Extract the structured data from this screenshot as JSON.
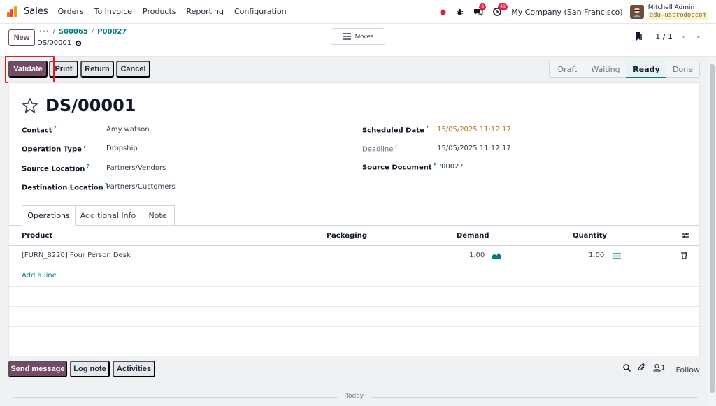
{
  "navbar": {
    "app_name": "Sales",
    "menu": [
      "Orders",
      "To Invoice",
      "Products",
      "Reporting",
      "Configuration"
    ],
    "messages_badge": "8",
    "activities_badge": "48",
    "company": "My Company (San Francisco)",
    "user_name": "Mitchell Admin",
    "user_db": "edu-userodoocom"
  },
  "control": {
    "new_label": "New",
    "breadcrumb": [
      "S00065",
      "P00027"
    ],
    "record_name": "DS/00001",
    "moves_label": "Moves",
    "pager": "1 / 1"
  },
  "actions": {
    "validate": "Validate",
    "print": "Print",
    "return": "Return",
    "cancel": "Cancel"
  },
  "status": {
    "stages": [
      "Draft",
      "Waiting",
      "Ready",
      "Done"
    ],
    "active": "Ready"
  },
  "form": {
    "title": "DS/00001",
    "contact_label": "Contact",
    "contact": "Amy watson",
    "operation_type_label": "Operation Type",
    "operation_type": "Dropship",
    "source_location_label": "Source Location",
    "source_location": "Partners/Vendors",
    "destination_location_label": "Destination Location",
    "destination_location": "Partners/Customers",
    "scheduled_date_label": "Scheduled Date",
    "scheduled_date": "15/05/2025 11:12:17",
    "deadline_label": "Deadline",
    "deadline": "15/05/2025 11:12:17",
    "source_document_label": "Source Document",
    "source_document": "P00027"
  },
  "tabs": [
    "Operations",
    "Additional Info",
    "Note"
  ],
  "table": {
    "headers": {
      "product": "Product",
      "packaging": "Packaging",
      "demand": "Demand",
      "quantity": "Quantity"
    },
    "rows": [
      {
        "product": "[FURN_8220] Four Person Desk",
        "demand": "1.00",
        "quantity": "1.00"
      }
    ],
    "add_line": "Add a line"
  },
  "chatter": {
    "send_message": "Send message",
    "log_note": "Log note",
    "activities": "Activities",
    "followers_count": "1",
    "follow": "Follow",
    "today": "Today"
  },
  "colors": {
    "brand": "#714b67",
    "link": "#017e84",
    "warning_date": "#b7791f",
    "highlight": "#e11d1d"
  }
}
